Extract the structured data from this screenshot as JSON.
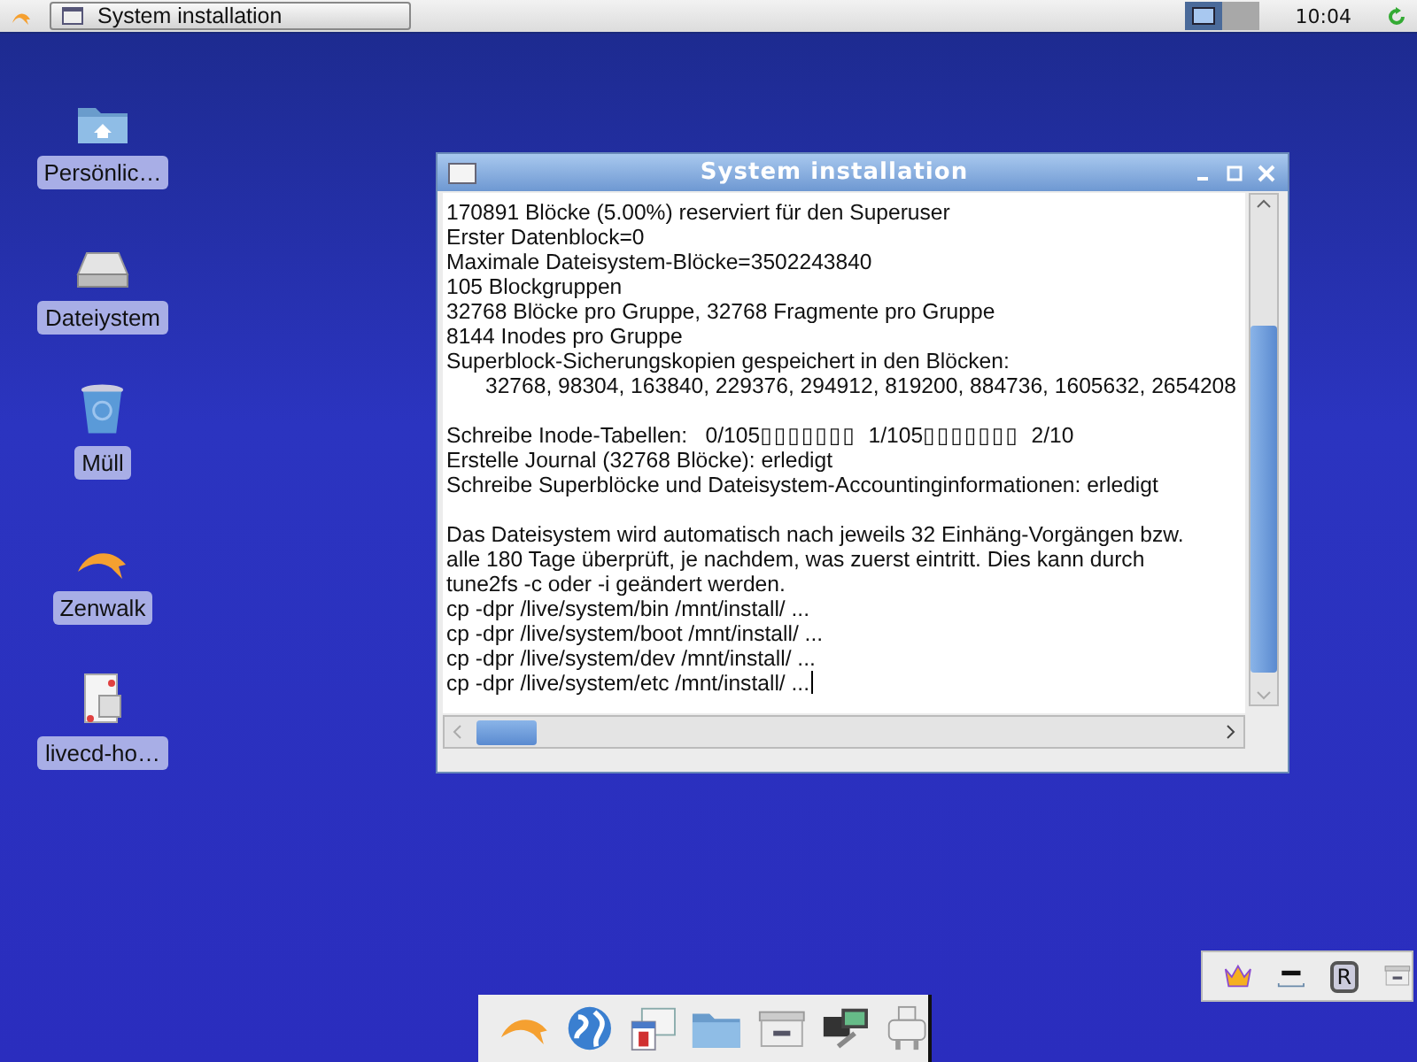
{
  "taskbar": {
    "window_button": "System installation",
    "workspaces": [
      {
        "selected": true
      },
      {
        "selected": false
      }
    ],
    "clock": "10:04"
  },
  "desktop_icons": [
    {
      "label": "Persönlic…",
      "kind": "home"
    },
    {
      "label": "Dateiystem",
      "kind": "drive"
    },
    {
      "label": "Müll",
      "kind": "trash"
    },
    {
      "label": "Zenwalk",
      "kind": "dolphin"
    },
    {
      "label": "livecd-ho…",
      "kind": "document"
    }
  ],
  "window": {
    "title": "System installation",
    "lines": [
      {
        "kind": "text",
        "text": "170891 Blöcke (5.00%) reserviert für den Superuser"
      },
      {
        "kind": "text",
        "text": "Erster Datenblock=0"
      },
      {
        "kind": "text",
        "text": "Maximale Dateisystem-Blöcke=3502243840"
      },
      {
        "kind": "text",
        "text": "105 Blockgruppen"
      },
      {
        "kind": "text",
        "text": "32768 Blöcke pro Gruppe, 32768 Fragmente pro Gruppe"
      },
      {
        "kind": "text",
        "text": "8144 Inodes pro Gruppe"
      },
      {
        "kind": "text",
        "text": "Superblock-Sicherungskopien gespeichert in den Blöcken:"
      },
      {
        "kind": "indented",
        "text": "32768, 98304, 163840, 229376, 294912, 819200, 884736, 1605632, 2654208"
      },
      {
        "kind": "blank"
      },
      {
        "kind": "progress",
        "parts": [
          {
            "kind": "text",
            "text": "Schreibe Inode-Tabellen:   0/105"
          },
          {
            "kind": "glyphs",
            "text": "▯▯▯▯▯▯▯"
          },
          {
            "kind": "text",
            "text": "  1/105"
          },
          {
            "kind": "glyphs",
            "text": "▯▯▯▯▯▯▯"
          },
          {
            "kind": "text",
            "text": "  2/10"
          }
        ]
      },
      {
        "kind": "text",
        "text": "Erstelle Journal (32768 Blöcke): erledigt"
      },
      {
        "kind": "text",
        "text": "Schreibe Superblöcke und Dateisystem-Accountinginformationen: erledigt"
      },
      {
        "kind": "blank"
      },
      {
        "kind": "text",
        "text": "Das Dateisystem wird automatisch nach jeweils 32 Einhäng-Vorgängen bzw."
      },
      {
        "kind": "text",
        "text": "alle 180 Tage überprüft, je nachdem, was zuerst eintritt. Dies kann durch"
      },
      {
        "kind": "text",
        "text": "tune2fs -c oder -i geändert werden."
      },
      {
        "kind": "text",
        "text": "cp -dpr /live/system/bin /mnt/install/ ..."
      },
      {
        "kind": "text",
        "text": "cp -dpr /live/system/boot /mnt/install/ ..."
      },
      {
        "kind": "text",
        "text": "cp -dpr /live/system/dev /mnt/install/ ..."
      },
      {
        "kind": "text",
        "text": "cp -dpr /live/system/etc /mnt/install/ ...",
        "cursor": true
      }
    ]
  },
  "dock": [
    {
      "kind": "dolphin"
    },
    {
      "kind": "globe"
    },
    {
      "kind": "calendar"
    },
    {
      "kind": "folder"
    },
    {
      "kind": "drawer"
    },
    {
      "kind": "network"
    },
    {
      "kind": "printer"
    }
  ],
  "tray": [
    {
      "kind": "crown"
    },
    {
      "kind": "dash"
    },
    {
      "kind": "letter",
      "text": "R"
    },
    {
      "kind": "drawer"
    }
  ]
}
